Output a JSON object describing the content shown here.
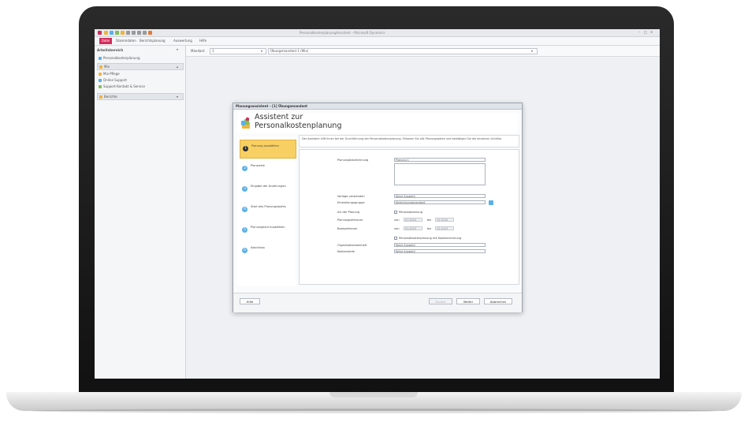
{
  "colors": {
    "accent": "#d22c5b",
    "active_step": "#f7cf63",
    "step_icon": "#5ab0e8"
  },
  "window": {
    "title": "PersonalkostenplanungAssistent – Microsoft Dynamics",
    "controls": [
      "–",
      "□",
      "×"
    ]
  },
  "ribbon": {
    "file_tab": "Datei",
    "tabs": [
      "Stammdaten",
      "Berichtsplanung",
      "Auswertung",
      "Hilfe"
    ]
  },
  "sidebar": {
    "header": "Arbeitsbereich",
    "items": [
      {
        "label": "Personalkostenplanung",
        "icon": "folder-icon",
        "kind": "row"
      },
      {
        "label": "Mix",
        "icon": "folder-icon",
        "kind": "group"
      },
      {
        "label": "Mix-Pflege",
        "icon": "folder-icon",
        "kind": "row"
      },
      {
        "label": "Online Support",
        "icon": "help-icon",
        "kind": "row"
      },
      {
        "label": "Support-Kontakt & Service",
        "icon": "mail-icon",
        "kind": "row"
      },
      {
        "label": "Berichte",
        "icon": "folder-icon",
        "kind": "group"
      }
    ]
  },
  "toolbar": {
    "mandant_label": "Mandant",
    "mandant_value": "1",
    "company_value": "Übungsmandant 1 (Mix)"
  },
  "dialog": {
    "titlebar": "Planungsassistent – [1] Übungsmandant",
    "heading": "Assistent zur Personalkostenplanung",
    "description": "Der Assistent hilft Ihnen bei der Durchführung der Personalkostenplanung. Erfassen Sie alle Planungsdaten und bestätigen Sie die einzelnen Schritte.",
    "steps": [
      {
        "num": "1",
        "label": "Planung auswählen",
        "active": true
      },
      {
        "num": "2",
        "label": "Planwerte",
        "active": false
      },
      {
        "num": "3",
        "label": "Eingabe der Änderungen",
        "active": false
      },
      {
        "num": "4",
        "label": "Start des Planungslaufes",
        "active": false
      },
      {
        "num": "5",
        "label": "Planungslauf auswählen",
        "active": false
      },
      {
        "num": "6",
        "label": "Abschluss",
        "active": false
      }
    ],
    "form": {
      "bezeichnung_label": "Planungsbezeichnung",
      "bezeichnung_value": "Planung 1",
      "vorlage_label": "Vorlage verwenden",
      "vorlage_value": "Keine Auswahl",
      "gruppe_label": "Einstellungsgruppe",
      "gruppe_value": "Abrechnungsmandant",
      "art_label": "Art der Planung",
      "art_option": "Personalplanung",
      "zeitraum_label": "Planungszeitraum",
      "bis_label": "bis",
      "von_label": "von",
      "zeitraum_von": "01.2024",
      "zeitraum_bis": "12.2024",
      "basis_label": "Basiszeitraum",
      "basis_von": "01.2023",
      "basis_bis": "12.2023",
      "check_option": "Personalkostenplanung mit Kostenrechnung",
      "org_label": "Organisationseinheit",
      "org_value": "Keine Auswahl",
      "kst_label": "Kostenstelle",
      "kst_value": "Keine Auswahl"
    },
    "buttons": {
      "help": "Hilfe",
      "back": "Zurück",
      "next": "Weiter",
      "cancel": "Abbrechen"
    }
  }
}
